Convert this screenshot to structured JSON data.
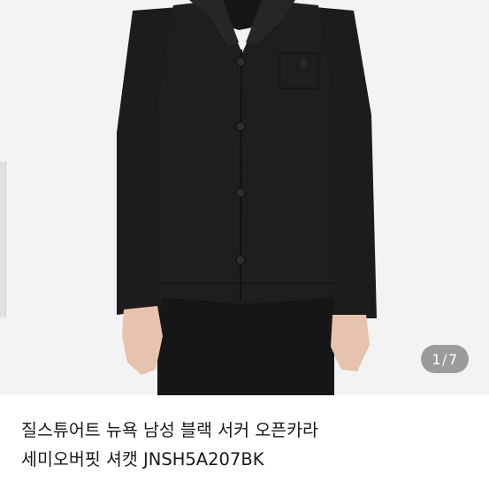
{
  "gallery": {
    "image_alt": "Black semi-overfit shirt jacket product photo",
    "current": "1",
    "separator": "/",
    "total": "7"
  },
  "product": {
    "title_line1": "질스튜어트 뉴욕 남성 블랙 서커 오픈카라",
    "title_line2": "세미오버핏 셔캣 JNSH5A207BK"
  },
  "colors": {
    "background": "#f3f3f3",
    "garment": "#1b1b1b",
    "skin": "#e7c2ad",
    "counter_pill": "#787878"
  }
}
